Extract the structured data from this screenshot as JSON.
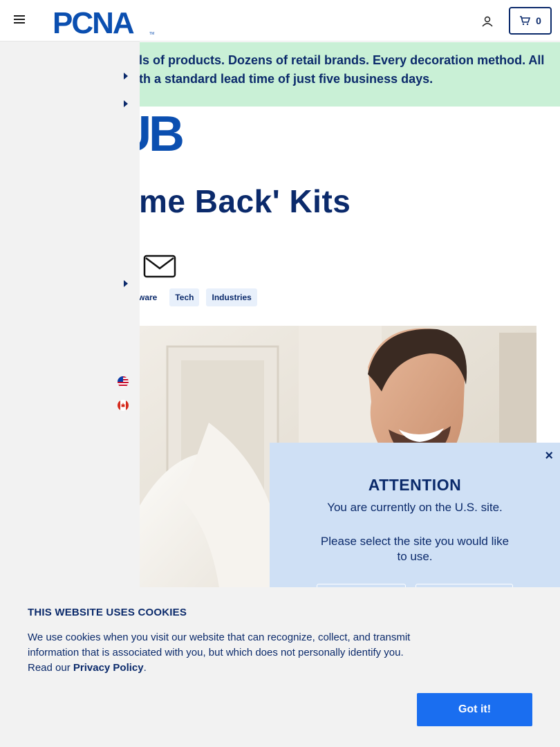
{
  "header": {
    "logo_text": "PCNA",
    "cart_count": "0"
  },
  "banner": {
    "line1": "ls of products. Dozens of retail brands. Every decoration method. All",
    "line2": "th a standard lead time of just five business days."
  },
  "article": {
    "hub_logo_text": "UB",
    "title": "me Back' Kits",
    "tags": [
      "ware",
      "Tech",
      "Industries"
    ]
  },
  "sidebar": {
    "flags": [
      "us-flag-icon",
      "canada-flag-icon"
    ]
  },
  "modal": {
    "close_label": "×",
    "heading": "ATTENTION",
    "line1": "You are currently on the U.S. site.",
    "line2": "Please select the site you would like to use."
  },
  "cookie": {
    "heading": "THIS WEBSITE USES COOKIES",
    "body": "We use cookies when you visit our website that can recognize, collect, and transmit information that is associated with you, but which does not personally identify you. Read our ",
    "link": "Privacy Policy",
    "period": ".",
    "button": "Got it!"
  },
  "colors": {
    "brand_navy": "#0b2a6b",
    "banner_green": "#c9f0d6",
    "modal_blue": "#cfe0f5",
    "cookie_button": "#1a6ef0"
  }
}
